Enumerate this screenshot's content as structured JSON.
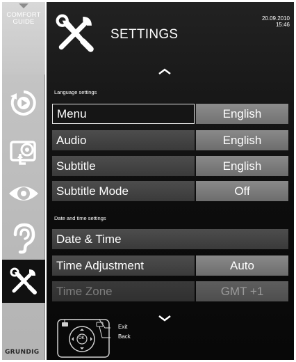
{
  "sidebar": {
    "comfort_guide": [
      "COMFORT",
      "GUIDE"
    ],
    "items": [
      {
        "name": "source-icon"
      },
      {
        "name": "picture-icon"
      },
      {
        "name": "eye-icon"
      },
      {
        "name": "ear-icon"
      },
      {
        "name": "settings-tools-icon"
      }
    ],
    "brand": "GRUNDIG"
  },
  "header": {
    "icon": "settings-tools-icon",
    "title": "SETTINGS",
    "date": "20.09.2010",
    "time": "15:46"
  },
  "sections": [
    {
      "label": "Language settings",
      "rows": [
        {
          "label": "Menu",
          "value": "English",
          "state": "selected"
        },
        {
          "label": "Audio",
          "value": "English",
          "state": "normal"
        },
        {
          "label": "Subtitle",
          "value": "English",
          "state": "normal"
        },
        {
          "label": "Subtitle Mode",
          "value": "Off",
          "state": "normal"
        }
      ]
    },
    {
      "label": "Date and time settings",
      "rows": [
        {
          "label": "Date & Time",
          "value": null,
          "state": "normal"
        },
        {
          "label": "Time Adjustment",
          "value": "Auto",
          "state": "normal"
        },
        {
          "label": "Time Zone",
          "value": "GMT +1",
          "state": "disabled"
        }
      ]
    }
  ],
  "help": {
    "exit": "Exit",
    "back": "Back",
    "ok": "OK"
  }
}
